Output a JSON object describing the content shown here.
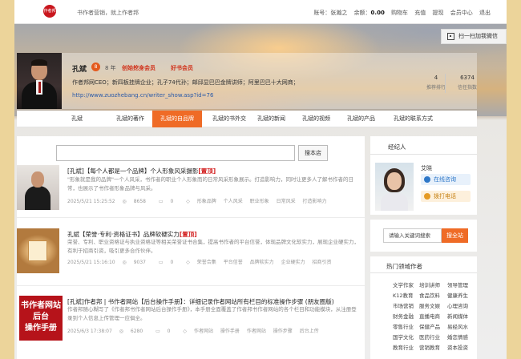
{
  "header": {
    "logo_text": "作者邦",
    "slogan": "书作者营销，就上作者邦",
    "account_label": "账号：张瀚之",
    "balance_label": "余额：",
    "balance_value": "0.00",
    "nav": [
      "购物车",
      "充值",
      "提现",
      "会员中心",
      "退出"
    ]
  },
  "qr_button": {
    "label": "扫一扫加我微信"
  },
  "profile": {
    "name": "孔斌",
    "medal": "8",
    "years": "8 年",
    "badge_founder": "创始挖身会员",
    "badge_author": "好书会员",
    "bio": "作者邦网CEO；新四板挂牌企业；孔子74代孙；邮邱显巴巴金牌讲师；阿里巴巴十大网商；",
    "link": "http://www.zuozhebang.cn/writer_show.asp?id=76",
    "stats": [
      {
        "value": "4",
        "label": "推荐排行"
      },
      {
        "value": "6374",
        "label": "信任指数"
      }
    ]
  },
  "tabs": [
    "孔斌",
    "孔斌的著作",
    "孔斌的自品牌",
    "孔斌的书外交",
    "孔斌的新闻",
    "孔斌的视频",
    "孔斌的产品",
    "孔斌的联系方式"
  ],
  "search": {
    "button": "搜本店"
  },
  "articles": [
    {
      "title": "[孔斌]【每个人都是一个品牌】个人形象风采摄影",
      "tag": "[置顶]",
      "desc": "\"形象就是我的品牌\"一个人风采，书作者的职业个人形象而的日常风采形象展示。打造影响力，同时让更多人了解书作者的日常，也展示了书作者形象品牌与风采。",
      "date": "2025/5/21 15:25:52",
      "views": "8658",
      "comments": "0",
      "tags": [
        "形象品牌",
        "个人风采",
        "职业形象",
        "日常风采",
        "打造影响力"
      ]
    },
    {
      "title": "孔斌【荣誉·专利·资格证书】品牌软硬实力",
      "tag": "[置顶]",
      "desc": "荣誉、专利、职业资格证与执业资格证等相关荣誉证书合集，提高书作者的平台信誉，体现品牌文化软实力，展现企业硬实力，有利于招商引资，吸引更多合作伙伴。",
      "date": "2025/5/21 15:16:10",
      "views": "9037",
      "comments": "0",
      "tags": [
        "荣誉合集",
        "平台信誉",
        "品牌软实力",
        "企业硬实力",
        "招商引资"
      ]
    },
    {
      "title": "[孔斌]作者邦 | 书作者网站【后台操作手册】：详细记录作者网站所有栏目的标准操作步骤 (朋友圈版)",
      "tag": "",
      "desc": "作者邦随心糊写了《作者邦书作者网站后台操作手册》，本手册全面覆盖了作者邦书作者网站的各个栏目和功能模块，从注册登录到个人信息上传管理一应俱全。",
      "date": "2025/6/3 17:38:07",
      "views": "6280",
      "comments": "0",
      "tags": [
        "作者网站",
        "操作手册",
        "作者网站",
        "操作步骤",
        "后台上传"
      ],
      "thumb_text": "书作者网站后台操作手册"
    }
  ],
  "agent": {
    "heading": "经纪人",
    "name": "艾晓",
    "online_btn": "在线咨询",
    "phone_btn": "拨打电话"
  },
  "site_search": {
    "placeholder": "请输入关键词搜索",
    "button": "搜全站"
  },
  "hot_authors": {
    "heading": "热门领域作者",
    "items": [
      "文学作家",
      "培训讲师",
      "领导管理",
      "K12教育",
      "食品饮料",
      "健康养生",
      "市场营销",
      "服务文娱",
      "心理咨询",
      "财务金融",
      "直播电商",
      "新闻媒体",
      "零售行业",
      "保健产品",
      "易经风水",
      "国学文化",
      "医药行业",
      "婚恋情感",
      "教育行业",
      "营销教育",
      "资本投资"
    ]
  },
  "colors": {
    "accent": "#ef6b26",
    "top_tag": "#d21f1f",
    "link": "#2a5aa8"
  }
}
